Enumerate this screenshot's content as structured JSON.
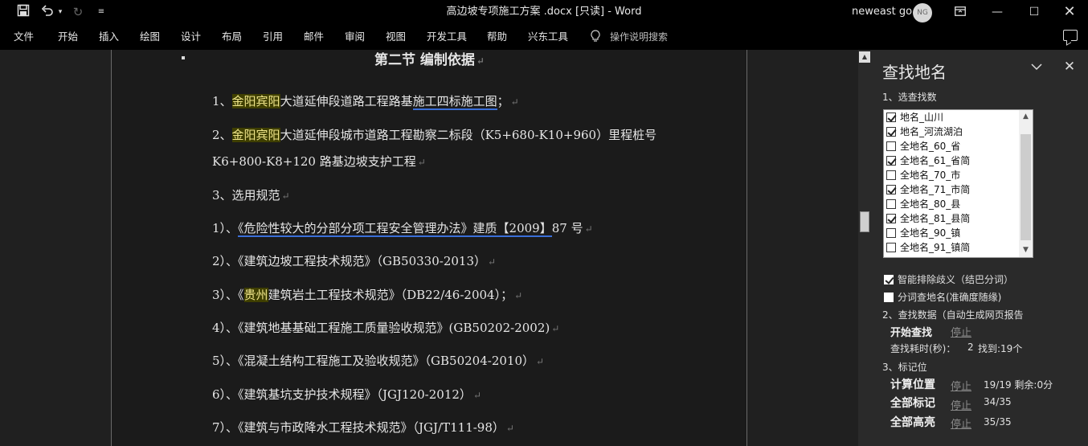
{
  "titlebar": {
    "document_title": "高边坡专项施工方案 .docx [只读]  -  Word",
    "user_name": "neweast go",
    "avatar_initials": "NG"
  },
  "menu": {
    "items": [
      "文件",
      "开始",
      "插入",
      "绘图",
      "设计",
      "布局",
      "引用",
      "邮件",
      "审阅",
      "视图",
      "开发工具",
      "帮助",
      "兴东工具"
    ],
    "tell_me": "操作说明搜索"
  },
  "document": {
    "heading": "第二节  编制依据",
    "lines": {
      "l1_num": "1、",
      "l1_hl": "金阳宾阳",
      "l1_mid": "大道延伸段道路工程路基",
      "l1_ul": "施工四标施工图",
      "l1_end": "；",
      "l2_num": "2、",
      "l2_hl": "金阳宾阳",
      "l2_rest": "大道延伸段城市道路工程勘察二标段（K5+680-K10+960）里程桩号",
      "l2b": "K6+800-K8+120 路基边坡支护工程",
      "l3": "3、选用规范",
      "r1_num": "1）、",
      "r1_ul": "《危险性较大的分部分项工程安全管理办法》建质【2009】",
      "r1_end": "87 号",
      "r2": "2）、《建筑边坡工程技术规范》（GB50330-2013）",
      "r3_num": "3）、《",
      "r3_hl": "贵州",
      "r3_rest": "建筑岩土工程技术规范》（DB22/46-2004）；",
      "r4": "4）、《建筑地基基础工程施工质量验收规范》(GB50202-2002)",
      "r5": "5）、《混凝土结构工程施工及验收规范》（GB50204-2010）",
      "r6": "6）、《建筑基坑支护技术规程》（JGJ120-2012）",
      "r7": "7）、《建筑与市政降水工程技术规范》（JGJ/T111-98）"
    },
    "para_mark": "↵",
    "highlight_color": "#3f3f00"
  },
  "pane": {
    "title": "查找地名",
    "step1": "1、选查找数",
    "list": [
      {
        "label": "地名_山川",
        "checked": true
      },
      {
        "label": "地名_河流湖泊",
        "checked": true
      },
      {
        "label": "全地名_60_省",
        "checked": false
      },
      {
        "label": "全地名_61_省简",
        "checked": true
      },
      {
        "label": "全地名_70_市",
        "checked": false
      },
      {
        "label": "全地名_71_市简",
        "checked": true
      },
      {
        "label": "全地名_80_县",
        "checked": false
      },
      {
        "label": "全地名_81_县简",
        "checked": true
      },
      {
        "label": "全地名_90_镇",
        "checked": false
      },
      {
        "label": "全地名_91_镇简",
        "checked": false
      }
    ],
    "opt_smart": "智能排除歧义（结巴分词）",
    "opt_smart_checked": true,
    "opt_split": "分词查地名(准确度随缘)",
    "opt_split_checked": false,
    "step2": "2、查找数据（自动生成网页报告",
    "start_find": "开始查找",
    "stop1": "停止",
    "elapsed_label": "查找耗时(秒)：",
    "elapsed_value": "2",
    "found": "找到:19个",
    "step3": "3、标记位",
    "calc_label": "计算位置",
    "stop2": "停止",
    "calc_status": "19/19 剩余:0分",
    "mark_all": "全部标记",
    "stop3": "停止",
    "mark_status": "34/35",
    "highlight_all": "全部高亮",
    "stop4": "停止",
    "highlight_status": "35/35"
  }
}
